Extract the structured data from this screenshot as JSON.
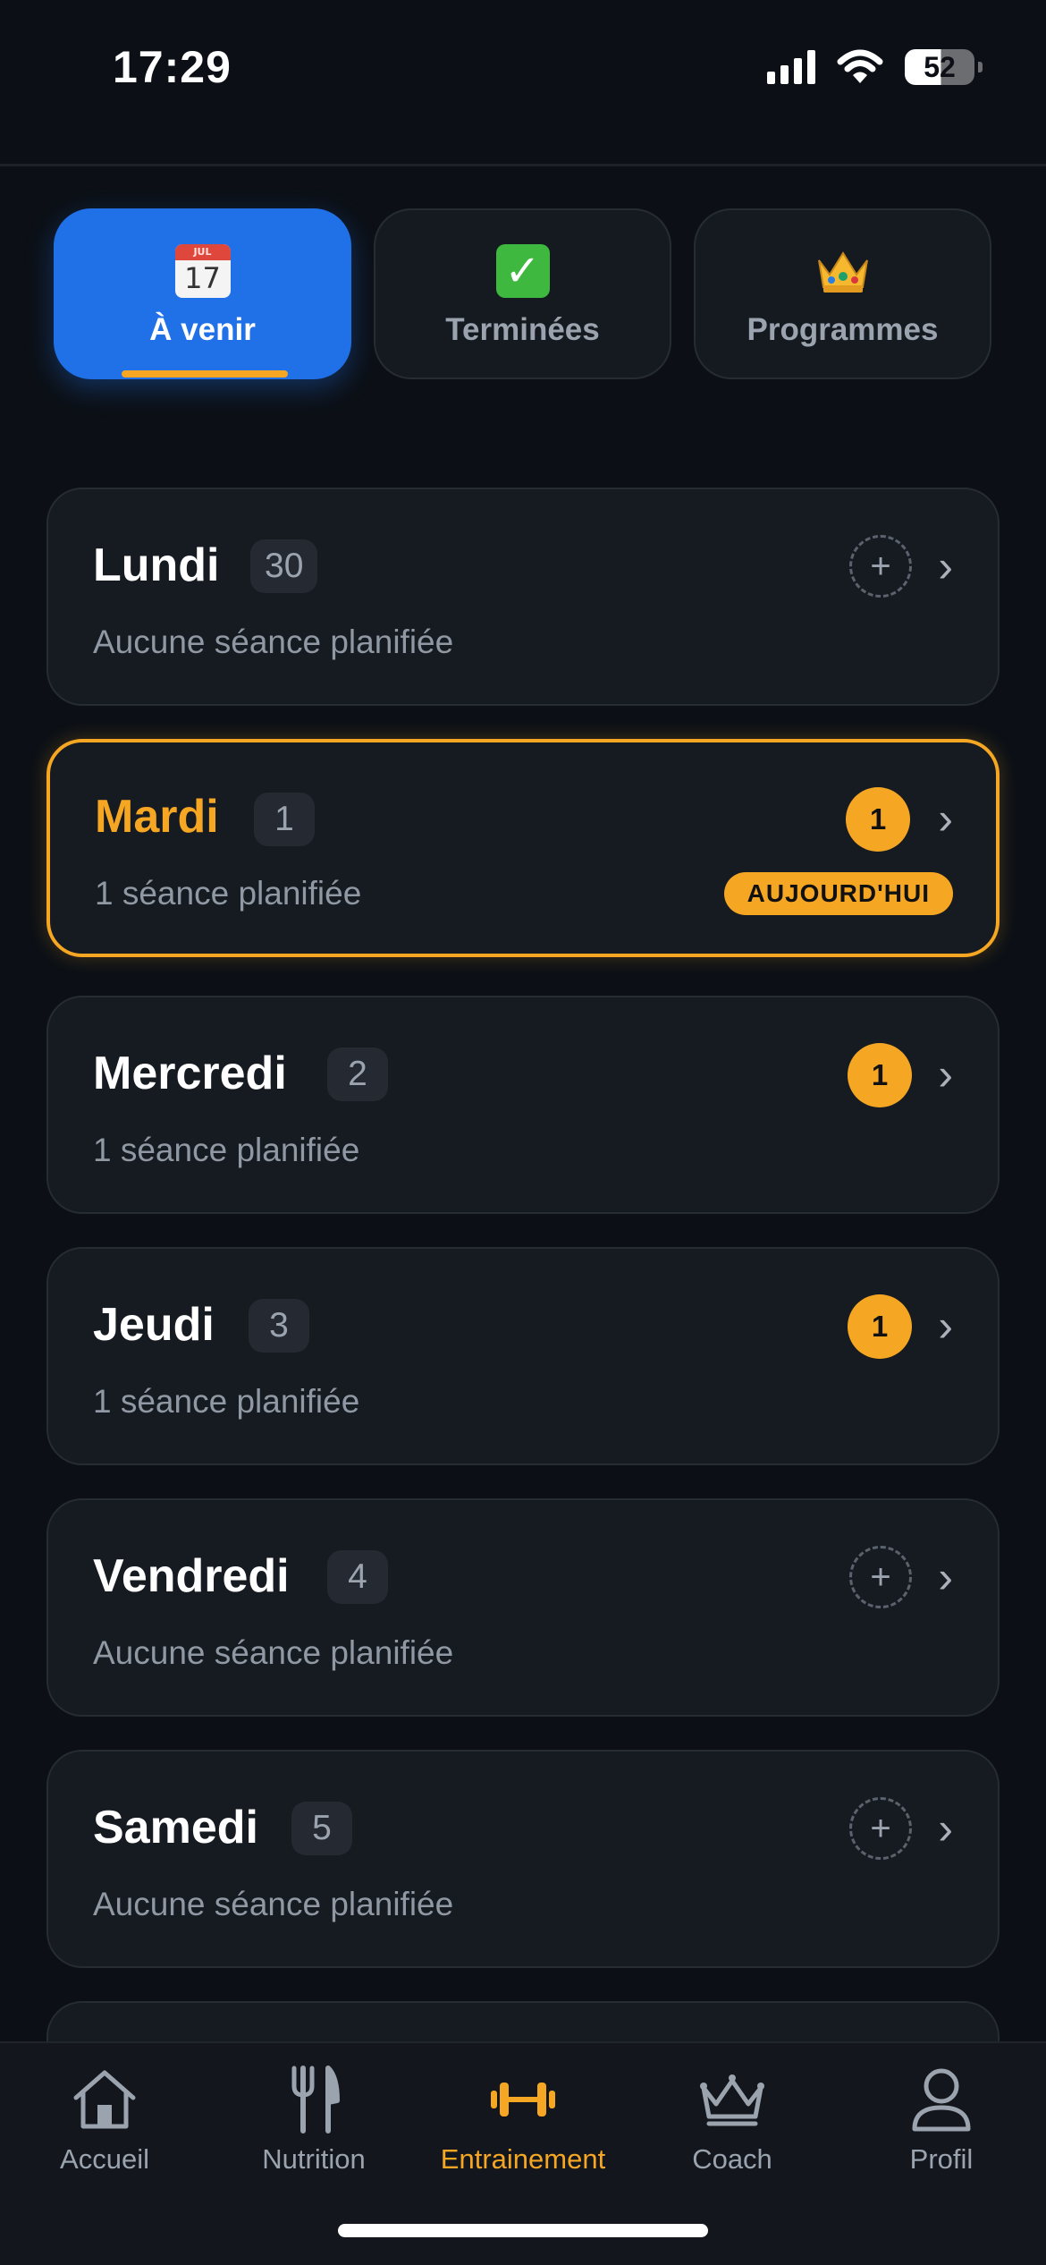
{
  "status_bar": {
    "time": "17:29",
    "battery": "52",
    "icons": [
      "signal-icon",
      "wifi-icon",
      "battery-icon"
    ]
  },
  "tabs": [
    {
      "icon": "calendar-icon",
      "label": "À venir",
      "active": true
    },
    {
      "icon": "check-icon",
      "label": "Terminées",
      "active": false
    },
    {
      "icon": "crown-icon",
      "label": "Programmes",
      "active": false
    }
  ],
  "days": [
    {
      "name": "Lundi",
      "date": "30",
      "subtitle": "Aucune séance planifiée",
      "sessions": null,
      "today": false
    },
    {
      "name": "Mardi",
      "date": "1",
      "subtitle": "1 séance planifiée",
      "sessions": "1",
      "today": true,
      "today_label": "AUJOURD'HUI"
    },
    {
      "name": "Mercredi",
      "date": "2",
      "subtitle": "1 séance planifiée",
      "sessions": "1",
      "today": false
    },
    {
      "name": "Jeudi",
      "date": "3",
      "subtitle": "1 séance planifiée",
      "sessions": "1",
      "today": false
    },
    {
      "name": "Vendredi",
      "date": "4",
      "subtitle": "Aucune séance planifiée",
      "sessions": null,
      "today": false
    },
    {
      "name": "Samedi",
      "date": "5",
      "subtitle": "Aucune séance planifiée",
      "sessions": null,
      "today": false
    }
  ],
  "card_symbols": {
    "add": "+",
    "chevron": "›"
  },
  "nav": [
    {
      "icon": "home-icon",
      "label": "Accueil",
      "active": false
    },
    {
      "icon": "fork-knife-icon",
      "label": "Nutrition",
      "active": false
    },
    {
      "icon": "dumbbell-icon",
      "label": "Entrainement",
      "active": true
    },
    {
      "icon": "crown-icon",
      "label": "Coach",
      "active": false
    },
    {
      "icon": "person-icon",
      "label": "Profil",
      "active": false
    }
  ],
  "colors": {
    "background": "#0c1016",
    "card": "#161a21",
    "accent_orange": "#f5a623",
    "accent_blue": "#2070e8",
    "muted_text": "#8f98a3"
  }
}
